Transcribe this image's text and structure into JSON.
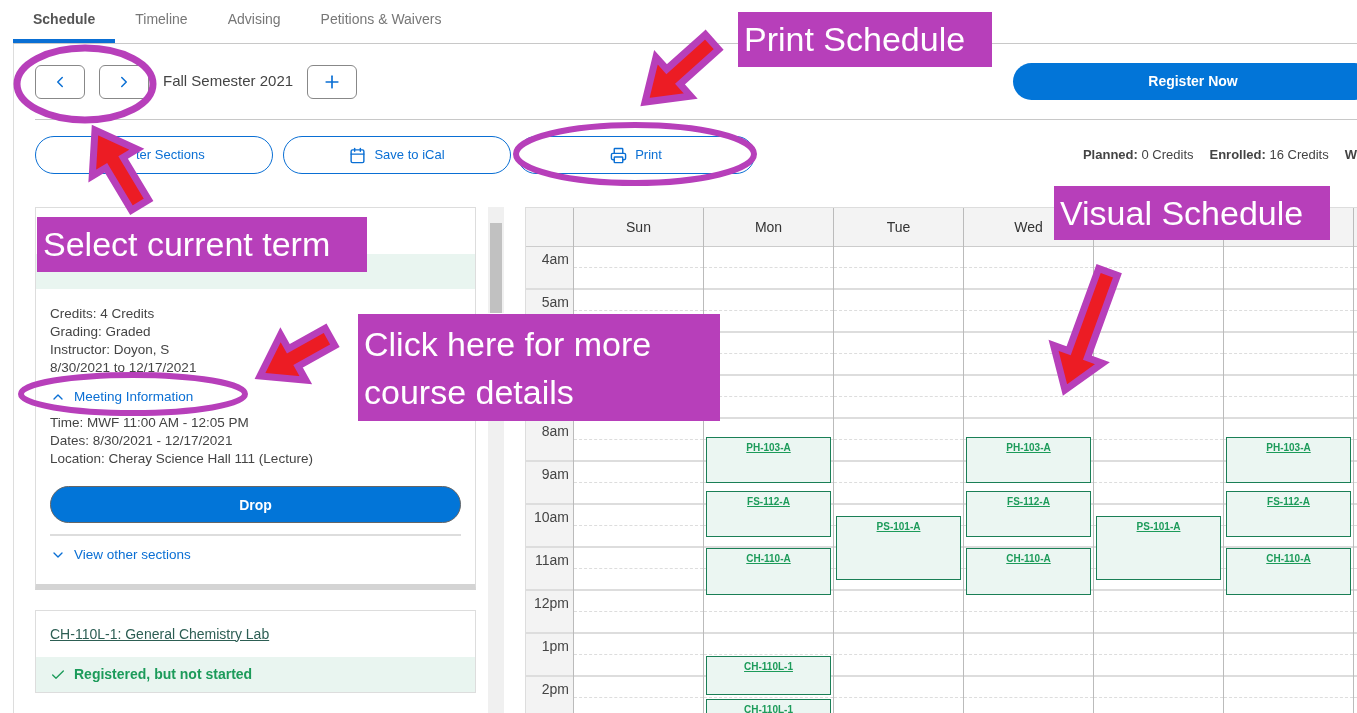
{
  "tabs": [
    {
      "label": "Schedule",
      "selected": true
    },
    {
      "label": "Timeline",
      "selected": false
    },
    {
      "label": "Advising",
      "selected": false
    },
    {
      "label": "Petitions & Waivers",
      "selected": false
    }
  ],
  "term": {
    "label": "Fall Semester 2021"
  },
  "register_button": "Register Now",
  "actions": [
    {
      "kind": "filter",
      "label": "ter Sections"
    },
    {
      "kind": "ical",
      "label": "Save to iCal"
    },
    {
      "kind": "print",
      "label": "Print"
    }
  ],
  "credit_stats": [
    {
      "label": "Planned:",
      "value": "0 Credits"
    },
    {
      "label": "Enrolled:",
      "value": "16 Credits"
    },
    {
      "label": "W"
    }
  ],
  "cards": [
    {
      "registered": true,
      "details": [
        "Credits: 4 Credits",
        "Grading: Graded",
        "Instructor: Doyon, S",
        "8/30/2021 to 12/17/2021"
      ],
      "meeting_toggle": {
        "label": "Meeting Information",
        "expanded": true
      },
      "meeting": [
        "Time: MWF 11:00 AM - 12:05 PM",
        "Dates: 8/30/2021 - 12/17/2021",
        "Location: Cheray Science Hall 111 (Lecture)"
      ],
      "drop_button": "Drop",
      "other_sections": {
        "label": "View other sections",
        "expanded": false
      }
    },
    {
      "title": "CH-110L-1: General Chemistry Lab",
      "registered": true,
      "status_text": "Registered, but not started"
    }
  ],
  "calendar": {
    "days": [
      {
        "label": "Sun"
      },
      {
        "label": "Mon",
        "events": [
          {
            "code": "PH-103-A"
          },
          {
            "code": "FS-112-A"
          },
          {
            "code": "CH-110-A"
          },
          {
            "code": "CH-110L-1"
          },
          {
            "code": "CH-110L-1"
          }
        ]
      },
      {
        "label": "Tue",
        "events": [
          {
            "code": "PS-101-A"
          }
        ]
      },
      {
        "label": "Wed",
        "events": [
          {
            "code": "PH-103-A"
          },
          {
            "code": "FS-112-A"
          },
          {
            "code": "CH-110-A"
          }
        ]
      },
      {
        "events": [
          {
            "code": "PS-101-A"
          }
        ]
      },
      {
        "events": [
          {
            "code": "PH-103-A"
          },
          {
            "code": "FS-112-A"
          },
          {
            "code": "CH-110-A"
          }
        ]
      }
    ],
    "hours": [
      "4am",
      "5am",
      "8am",
      "9am",
      "10am",
      "11am",
      "12pm",
      "1pm",
      "2pm"
    ]
  },
  "callouts": [
    "Print Schedule",
    "Select current term",
    "Click here for more course details",
    "Visual Schedule"
  ]
}
